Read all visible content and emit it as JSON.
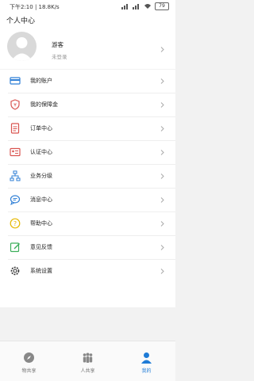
{
  "status_bar": {
    "time_speed": "下午2:10 | 18.8K/s",
    "battery": "79"
  },
  "header": {
    "title": "个人中心",
    "username": "游客",
    "login_status": "未登录"
  },
  "menu": {
    "items": [
      {
        "label": "我的账户",
        "icon": "account-card-icon"
      },
      {
        "label": "我的保障金",
        "icon": "deposit-shield-icon"
      },
      {
        "label": "订单中心",
        "icon": "order-document-icon"
      },
      {
        "label": "认证中心",
        "icon": "certification-id-icon"
      },
      {
        "label": "业务分级",
        "icon": "hierarchy-icon"
      },
      {
        "label": "消息中心",
        "icon": "message-bubble-icon"
      },
      {
        "label": "帮助中心",
        "icon": "help-question-icon"
      },
      {
        "label": "意见反馈",
        "icon": "feedback-edit-icon"
      },
      {
        "label": "系统设置",
        "icon": "gear-icon"
      }
    ]
  },
  "tabbar": {
    "tabs": [
      {
        "label": "物共享",
        "icon": "compass-icon",
        "active": false
      },
      {
        "label": "人共享",
        "icon": "people-icon",
        "active": false
      },
      {
        "label": "我的",
        "icon": "person-icon",
        "active": true
      }
    ]
  },
  "colors": {
    "accent": "#1e7bd6",
    "icon_blue": "#2f7fd6",
    "icon_red": "#d9534f",
    "icon_yellow": "#e6b800",
    "icon_green": "#3cae5a"
  }
}
